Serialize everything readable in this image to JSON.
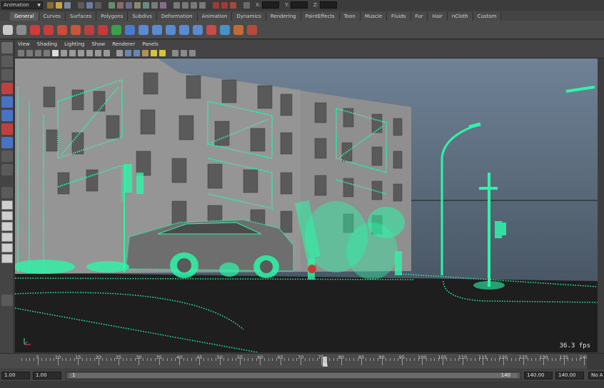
{
  "statusline": {
    "mode": "Animation",
    "coord_x": "X:",
    "coord_y": "Y:",
    "coord_z": "Z:"
  },
  "shelf": {
    "tabs": [
      "General",
      "Curves",
      "Surfaces",
      "Polygons",
      "Subdivs",
      "Deformation",
      "Animation",
      "Dynamics",
      "Rendering",
      "PaintEffects",
      "Toon",
      "Muscle",
      "Fluids",
      "Fur",
      "Hair",
      "nCloth",
      "Custom"
    ],
    "active_tab": "General"
  },
  "panel": {
    "menus": [
      "View",
      "Shading",
      "Lighting",
      "Show",
      "Renderer",
      "Panels"
    ]
  },
  "viewport": {
    "fps": "36.3 fps",
    "wire_color": "#2ef5a8",
    "sky_top": "#6f8296",
    "sky_bottom": "#222a33"
  },
  "timeline": {
    "ticks": [
      "5",
      "10",
      "15",
      "20",
      "25",
      "30",
      "35",
      "40",
      "45",
      "50",
      "55",
      "60",
      "65",
      "70",
      "75",
      "80",
      "85",
      "90",
      "95",
      "100",
      "105",
      "110",
      "115",
      "120",
      "125",
      "130",
      "135",
      "140"
    ],
    "current_frame": "76"
  },
  "range": {
    "start": "1.00",
    "anim_start": "1.00",
    "range_start": "1",
    "range_end": "140",
    "end": "140.00",
    "anim_end": "140.00",
    "no_anim": "No A"
  }
}
